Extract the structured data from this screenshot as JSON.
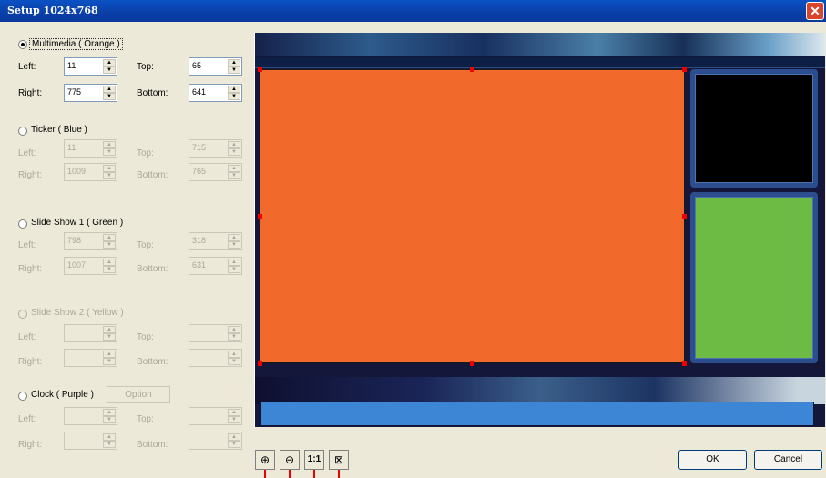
{
  "window": {
    "title": "Setup 1024x768",
    "close_glyph": "✕"
  },
  "sections": [
    {
      "label": "Multimedia ( Orange )",
      "checked": true,
      "enabled": true,
      "left": "11",
      "top": "65",
      "right": "775",
      "bottom": "641"
    },
    {
      "label": "Ticker ( Blue )",
      "checked": false,
      "enabled": false,
      "left": "11",
      "top": "715",
      "right": "1009",
      "bottom": "765"
    },
    {
      "label": "Slide Show 1 ( Green )",
      "checked": false,
      "enabled": false,
      "left": "798",
      "top": "318",
      "right": "1007",
      "bottom": "631"
    },
    {
      "label": "Slide Show 2 ( Yellow )",
      "checked": false,
      "enabled": false,
      "left": "",
      "top": "",
      "right": "",
      "bottom": ""
    },
    {
      "label": "Clock ( Purple )",
      "checked": false,
      "enabled": false,
      "left": "",
      "top": "",
      "right": "",
      "bottom": ""
    }
  ],
  "field_labels": {
    "left": "Left:",
    "top": "Top:",
    "right": "Right:",
    "bottom": "Bottom:"
  },
  "option_button": "Option",
  "toolbar": {
    "zoom_in": "⊕",
    "zoom_out": "⊖",
    "actual_size": "1:1",
    "fit": "⊠"
  },
  "buttons": {
    "ok": "OK",
    "cancel": "Cancel"
  },
  "colors": {
    "orange": "#f26a2b",
    "green": "#6dba45",
    "blue": "#3d86d6",
    "black": "#000000"
  }
}
